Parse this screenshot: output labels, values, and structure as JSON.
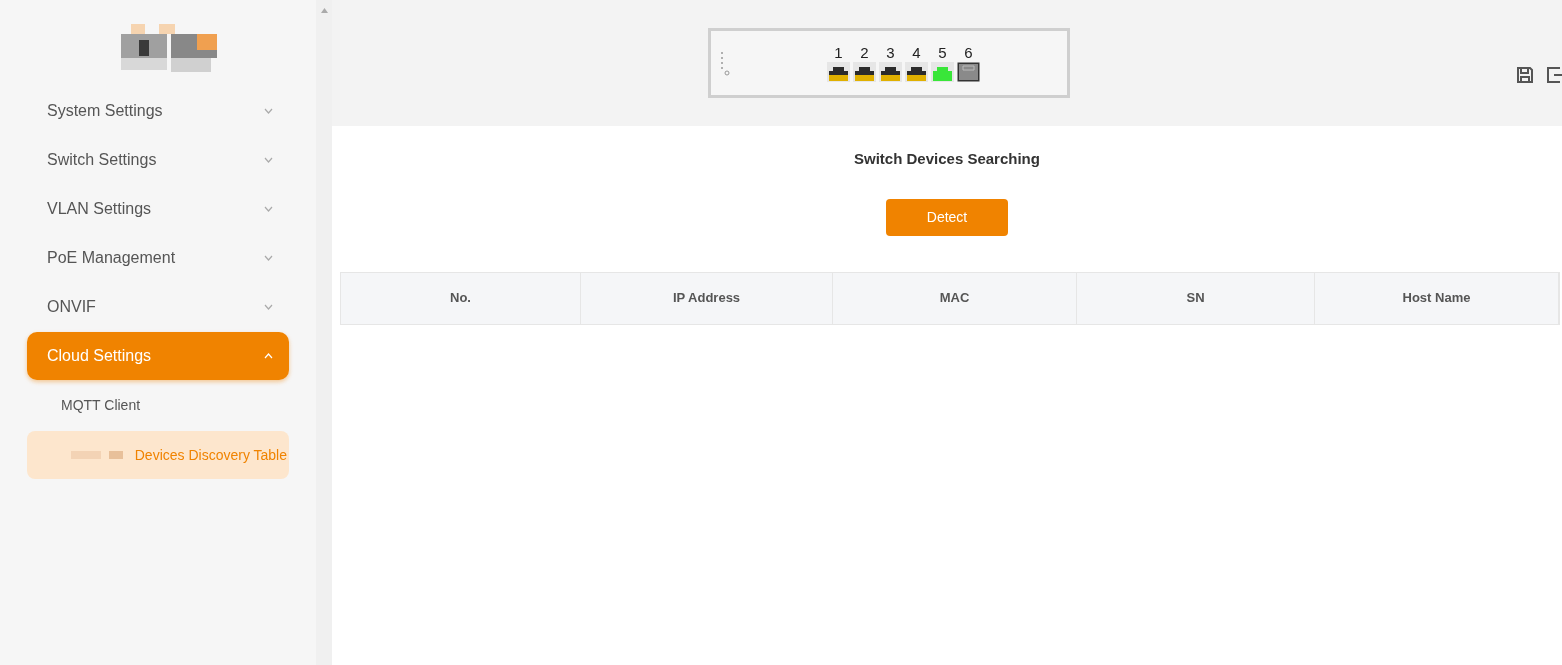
{
  "sidebar": {
    "items": [
      {
        "label": "System Settings",
        "expanded": false,
        "selected": false
      },
      {
        "label": "Switch Settings",
        "expanded": false,
        "selected": false
      },
      {
        "label": "VLAN Settings",
        "expanded": false,
        "selected": false
      },
      {
        "label": "PoE Management",
        "expanded": false,
        "selected": false
      },
      {
        "label": "ONVIF",
        "expanded": false,
        "selected": false
      },
      {
        "label": "Cloud Settings",
        "expanded": true,
        "selected": true,
        "children": [
          {
            "label": "MQTT Client",
            "selected": false
          },
          {
            "label": "Devices Discovery Table",
            "selected": true
          }
        ]
      }
    ]
  },
  "switch_panel": {
    "ports": [
      {
        "label": "1",
        "kind": "plugged",
        "color": "#e0b000"
      },
      {
        "label": "2",
        "kind": "plugged",
        "color": "#e0b000"
      },
      {
        "label": "3",
        "kind": "plugged",
        "color": "#e0b000"
      },
      {
        "label": "4",
        "kind": "plugged",
        "color": "#e0b000"
      },
      {
        "label": "5",
        "kind": "plugged",
        "color": "#39e639"
      },
      {
        "label": "6",
        "kind": "empty",
        "color": "#8a8a8a"
      }
    ]
  },
  "page": {
    "title": "Switch Devices Searching",
    "button": "Detect",
    "table": {
      "columns": [
        "No.",
        "IP Address",
        "MAC",
        "SN",
        "Host Name"
      ]
    }
  }
}
